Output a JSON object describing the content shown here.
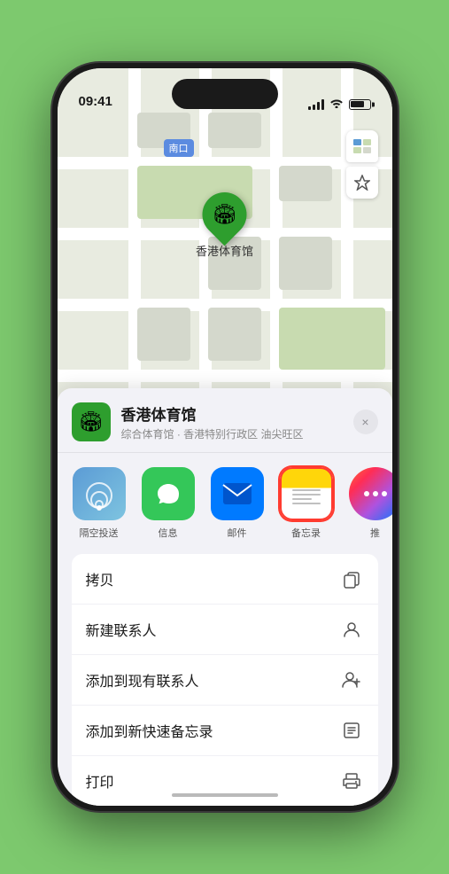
{
  "status_bar": {
    "time": "09:41",
    "navigation_arrow": "▲"
  },
  "map": {
    "south_entrance_label": "南口",
    "south_entrance_prefix": "南",
    "marker_label": "香港体育馆",
    "controls": {
      "map_icon": "🗺",
      "location_icon": "➤"
    }
  },
  "venue_card": {
    "name": "香港体育馆",
    "description": "综合体育馆 · 香港特别行政区 油尖旺区",
    "close_label": "×"
  },
  "share_actions": [
    {
      "id": "airdrop",
      "label": "隔空投送"
    },
    {
      "id": "messages",
      "label": "信息",
      "emoji": "💬"
    },
    {
      "id": "mail",
      "label": "邮件",
      "emoji": "✉️"
    },
    {
      "id": "notes",
      "label": "备忘录"
    },
    {
      "id": "more",
      "label": "推"
    }
  ],
  "menu_items": [
    {
      "label": "拷贝",
      "icon": "copy"
    },
    {
      "label": "新建联系人",
      "icon": "person"
    },
    {
      "label": "添加到现有联系人",
      "icon": "person-add"
    },
    {
      "label": "添加到新快速备忘录",
      "icon": "note"
    },
    {
      "label": "打印",
      "icon": "print"
    }
  ]
}
